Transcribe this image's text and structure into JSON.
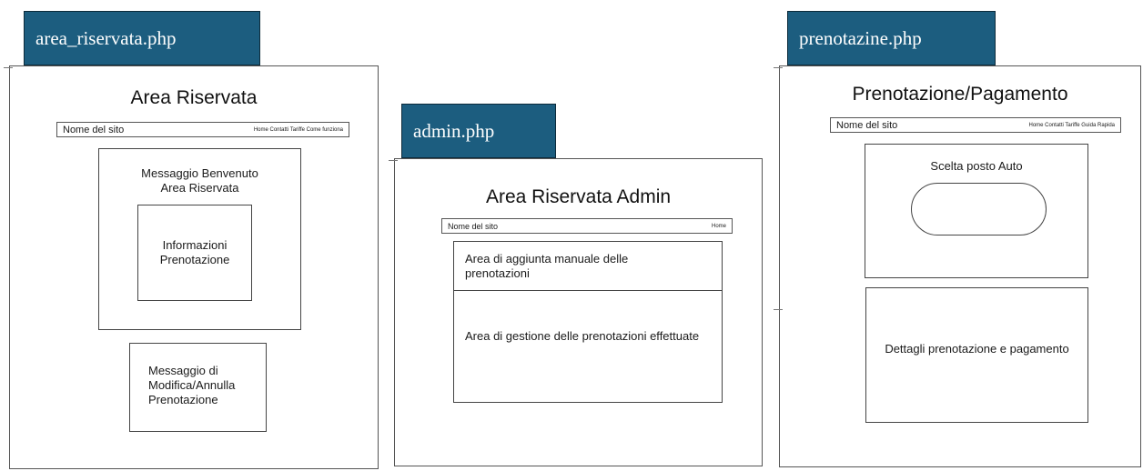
{
  "panels": {
    "area_riservata": {
      "tag": "area_riservata.php",
      "title": "Area Riservata",
      "nav": {
        "site": "Nome del sito",
        "links": "Home  Contatti  Tariffe  Come funziona"
      },
      "welcome": "Messaggio Benvenuto\nArea Riservata",
      "info": "Informazioni\nPrenotazione",
      "edit": "Messaggio di\nModifica/Annulla\nPrenotazione"
    },
    "admin": {
      "tag": "admin.php",
      "title": "Area Riservata Admin",
      "nav": {
        "site": "Nome del sito",
        "links": "Home"
      },
      "add_area": "Area di aggiunta manuale delle prenotazioni",
      "manage_area": "Area di gestione delle prenotazioni effettuate"
    },
    "prenotazione": {
      "tag": "prenotazine.php",
      "title": "Prenotazione/Pagamento",
      "nav": {
        "site": "Nome del sito",
        "links": "Home  Contatti  Tariffe  Guida Rapida"
      },
      "seat_label": "Scelta posto Auto",
      "details": "Dettagli prenotazione e pagamento"
    }
  }
}
